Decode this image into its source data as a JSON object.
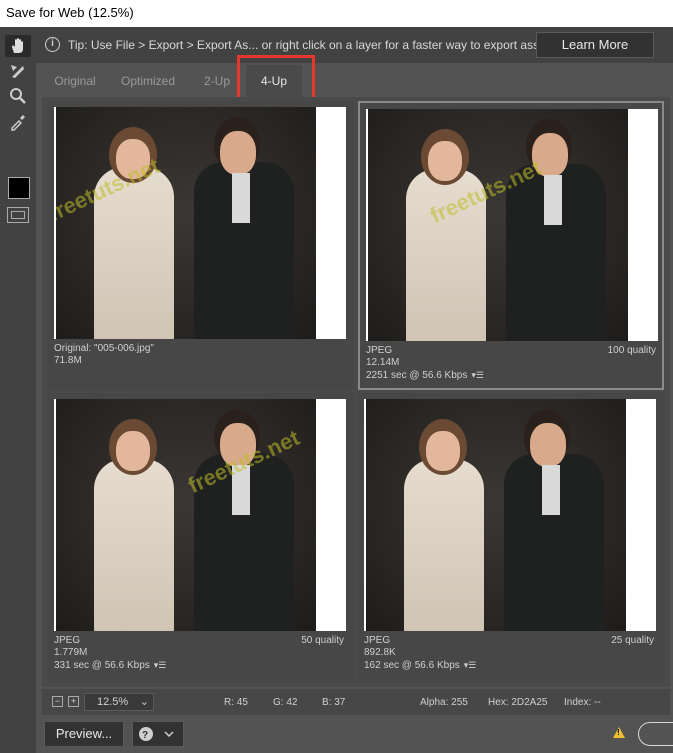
{
  "window": {
    "title": "Save for Web (12.5%)"
  },
  "tools": [
    "hand-tool",
    "slice-select-tool",
    "zoom-tool",
    "eyedropper-tool"
  ],
  "tip": {
    "text": "Tip: Use File > Export > Export As...  or right click on a layer for a faster way to export assets",
    "button": "Learn More"
  },
  "tabs": [
    "Original",
    "Optimized",
    "2-Up",
    "4-Up"
  ],
  "active_tab": "4-Up",
  "watermark": "freetuts.net",
  "panes": [
    {
      "line1": "Original: \"005-006.jpg\"",
      "line2": "71.8M",
      "line3": "",
      "quality": ""
    },
    {
      "line1": "JPEG",
      "line2": "12.14M",
      "line3": "2251 sec @ 56.6 Kbps",
      "quality": "100 quality"
    },
    {
      "line1": "JPEG",
      "line2": "1.779M",
      "line3": "331 sec @ 56.6 Kbps",
      "quality": "50 quality"
    },
    {
      "line1": "JPEG",
      "line2": "892.8K",
      "line3": "162 sec @ 56.6 Kbps",
      "quality": "25 quality"
    }
  ],
  "status": {
    "zoom": "12.5%",
    "r": "R: 45",
    "g": "G: 42",
    "b": "B: 37",
    "alpha": "Alpha: 255",
    "hex": "Hex: 2D2A25",
    "index": "Index: --"
  },
  "bottom": {
    "preview_button": "Preview..."
  },
  "colors": {
    "highlight": "#e8382a",
    "panel": "#535353"
  }
}
